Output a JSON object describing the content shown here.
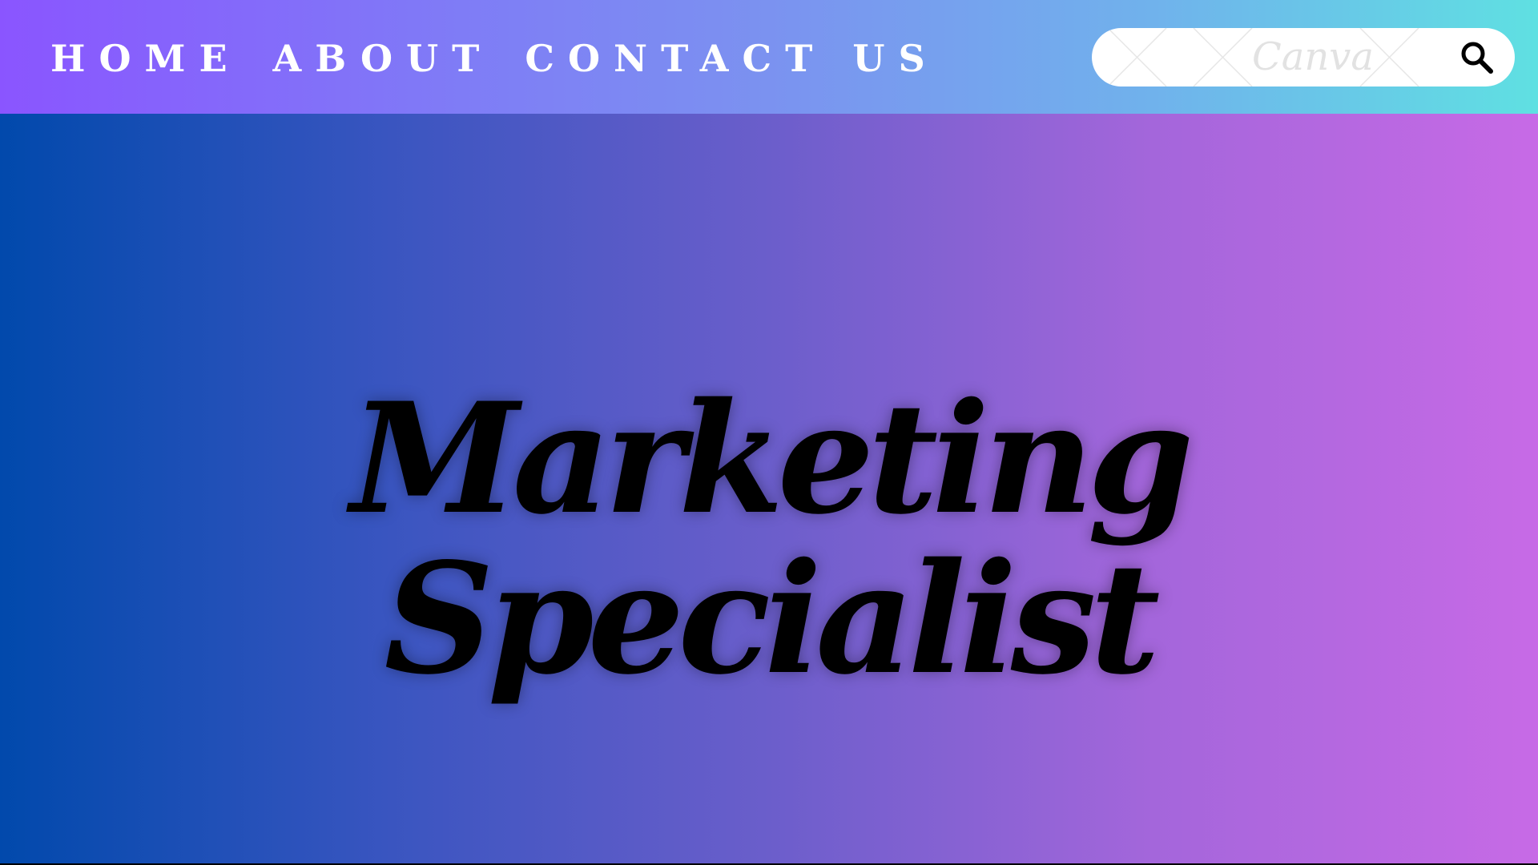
{
  "nav": {
    "links": [
      {
        "label": "HOME"
      },
      {
        "label": "ABOUT"
      },
      {
        "label": "CONTACT US"
      }
    ]
  },
  "search": {
    "placeholder": "",
    "value": "",
    "watermark": "Canva",
    "icon": "search-icon"
  },
  "hero": {
    "line1": "Marketing",
    "line2": "Specialist"
  },
  "colors": {
    "nav_gradient_start": "#8a55ff",
    "nav_gradient_end": "#5fe0e2",
    "hero_gradient_start": "#0149ac",
    "hero_gradient_end": "#c76ae6",
    "nav_text": "#ffffff",
    "hero_text": "#000000"
  }
}
